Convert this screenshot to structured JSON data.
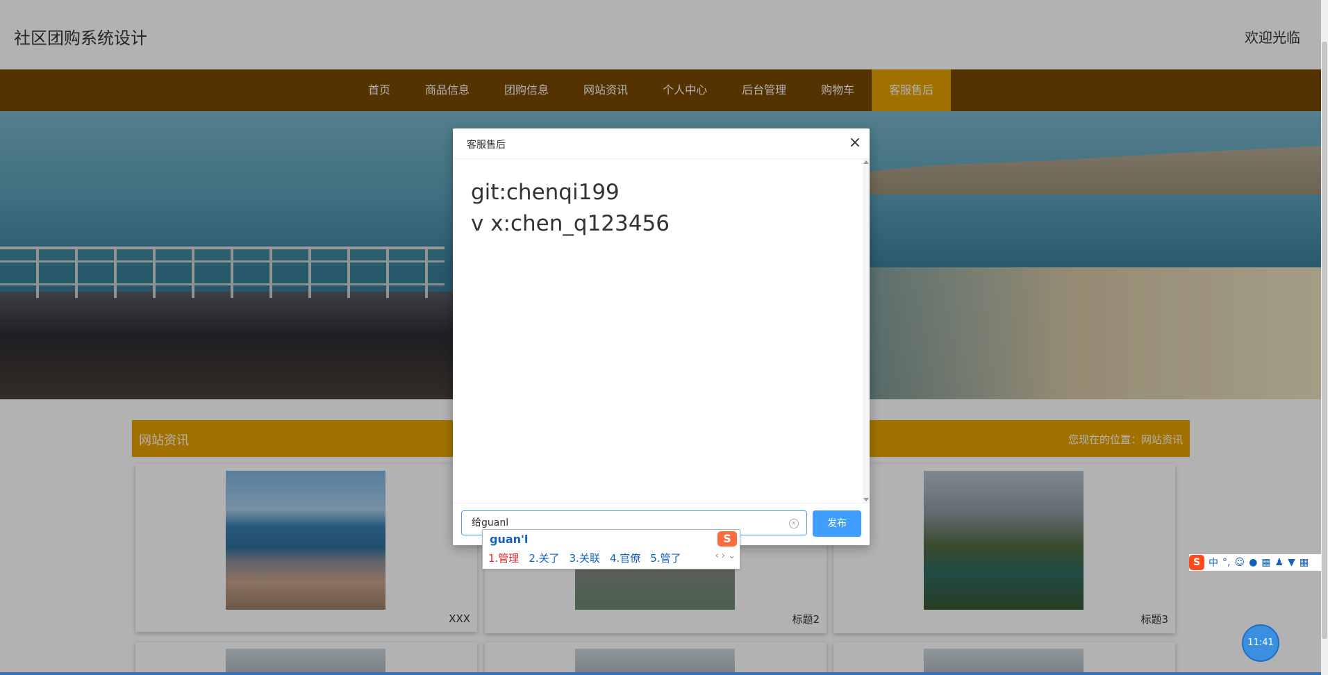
{
  "header": {
    "site_title": "社区团购系统设计",
    "welcome": "欢迎光临"
  },
  "nav": {
    "items": [
      {
        "label": "首页"
      },
      {
        "label": "商品信息"
      },
      {
        "label": "团购信息"
      },
      {
        "label": "网站资讯"
      },
      {
        "label": "个人中心"
      },
      {
        "label": "后台管理"
      },
      {
        "label": "购物车"
      },
      {
        "label": "客服售后"
      }
    ],
    "active_label": "客服售后"
  },
  "section": {
    "title": "网站资讯",
    "breadcrumb": "您现在的位置：网站资讯"
  },
  "cards": [
    {
      "caption": "XXX"
    },
    {
      "caption": "标题2"
    },
    {
      "caption": "标题3"
    }
  ],
  "modal": {
    "title": "客服售后",
    "close_icon": "close-icon",
    "messages": [
      "git:chenqi199",
      "v x:chen_q123456"
    ],
    "input_value": "给guanl",
    "send_label": "发布"
  },
  "ime": {
    "pinyin": "guan'l",
    "logo": "S",
    "candidates": [
      "1.管理",
      "2.关了",
      "3.关联",
      "4.官僚",
      "5.管了"
    ],
    "arrows": "‹ › ⌄"
  },
  "ime_toolbar": {
    "logo": "S",
    "mode": "中",
    "punct": "°,",
    "icons": [
      "smiley-icon",
      "mic-icon",
      "keyboard-icon",
      "user-icon",
      "shirt-icon",
      "grid-icon"
    ]
  },
  "clock": {
    "time": "11:41"
  },
  "colors": {
    "nav_bg": "#7a4a00",
    "accent": "#e5a300",
    "primary_button": "#409eff"
  }
}
